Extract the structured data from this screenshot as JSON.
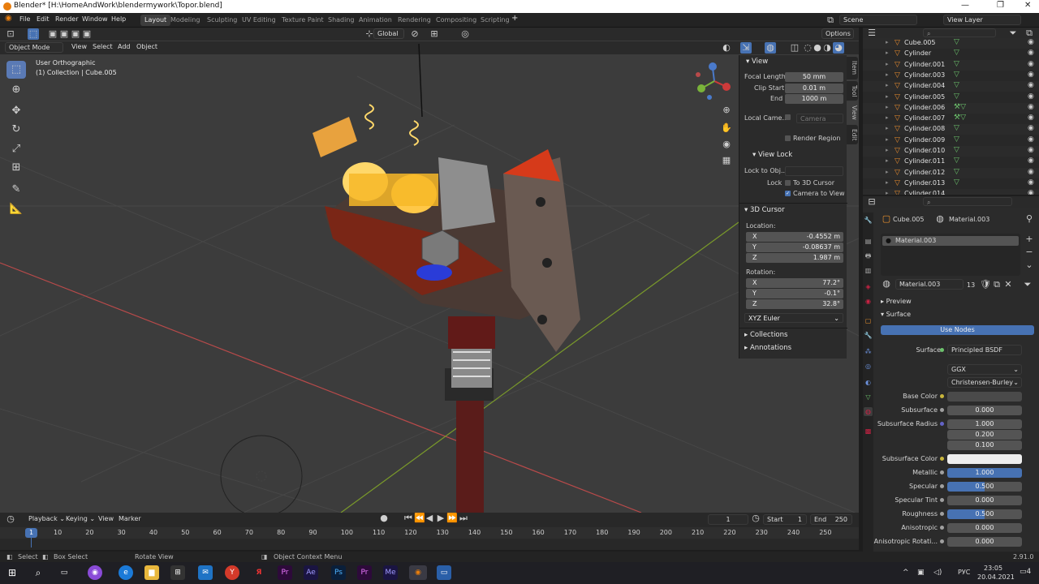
{
  "titlebar": {
    "title": "Blender* [H:\\HomeAndWork\\blendermywork\\Topor.blend]",
    "min": "—",
    "max": "❐",
    "close": "✕"
  },
  "menu": {
    "file": "File",
    "edit": "Edit",
    "render": "Render",
    "window": "Window",
    "help": "Help"
  },
  "workspaces": [
    "Layout",
    "Modeling",
    "Sculpting",
    "UV Editing",
    "Texture Paint",
    "Shading",
    "Animation",
    "Rendering",
    "Compositing",
    "Scripting"
  ],
  "scene": {
    "label": "Scene",
    "view_layer": "View Layer"
  },
  "header": {
    "orientation": "Global",
    "options": "Options",
    "mode": "Object Mode",
    "view": "View",
    "select": "Select",
    "add": "Add",
    "object": "Object"
  },
  "viewport": {
    "view_name": "User Orthographic",
    "collection": "(1) Collection | Cube.005"
  },
  "npanel": {
    "view_section": "View",
    "focal_label": "Focal Length",
    "focal_value": "50 mm",
    "clip_start_label": "Clip Start",
    "clip_start_value": "0.01 m",
    "end_label": "End",
    "end_value": "1000 m",
    "local_camera_label": "Local Came...",
    "camera_value": "Camera",
    "render_region": "Render Region",
    "view_lock": "View Lock",
    "lock_to_obj": "Lock to Obj...",
    "lock": "Lock",
    "to_3d_cursor": "To 3D Cursor",
    "camera_to_view": "Camera to View",
    "cursor_section": "3D Cursor",
    "location": "Location:",
    "x_label": "X",
    "x_value": "-0.4552 m",
    "y_label": "Y",
    "y_value": "-0.08637 m",
    "z_label": "Z",
    "z_value": "1.987 m",
    "rotation": "Rotation:",
    "rx_value": "77.2°",
    "ry_value": "-0.1°",
    "rz_value": "32.8°",
    "euler": "XYZ Euler",
    "collections": "Collections",
    "annotations": "Annotations",
    "tabs": [
      "Item",
      "Tool",
      "View",
      "Edit"
    ]
  },
  "outliner": {
    "items": [
      {
        "name": "Cube.005",
        "icons": "▽"
      },
      {
        "name": "Cylinder",
        "icons": "▽"
      },
      {
        "name": "Cylinder.001",
        "icons": "▽"
      },
      {
        "name": "Cylinder.003",
        "icons": "▽"
      },
      {
        "name": "Cylinder.004",
        "icons": "▽"
      },
      {
        "name": "Cylinder.005",
        "icons": "▽"
      },
      {
        "name": "Cylinder.006",
        "icons": "⚒▽"
      },
      {
        "name": "Cylinder.007",
        "icons": "⚒▽"
      },
      {
        "name": "Cylinder.008",
        "icons": "▽"
      },
      {
        "name": "Cylinder.009",
        "icons": "▽"
      },
      {
        "name": "Cylinder.010",
        "icons": "▽"
      },
      {
        "name": "Cylinder.011",
        "icons": "▽"
      },
      {
        "name": "Cylinder.012",
        "icons": "▽"
      },
      {
        "name": "Cylinder.013",
        "icons": "▽"
      },
      {
        "name": "Cylinder.014",
        "icons": ""
      }
    ]
  },
  "properties": {
    "object": "Cube.005",
    "material": "Material.003",
    "slot": "Material.003",
    "mat_name": "Material.003",
    "users": "13",
    "preview": "Preview",
    "surface_section": "Surface",
    "use_nodes": "Use Nodes",
    "surface_label": "Surface",
    "surface_value": "Principled BSDF",
    "distribution": "GGX",
    "subsurface_method": "Christensen-Burley",
    "rows": [
      {
        "label": "Base Color",
        "value": "",
        "type": "color-dark",
        "dot": "#c8b53c"
      },
      {
        "label": "Subsurface",
        "value": "0.000",
        "type": "plain",
        "dot": "#a0a0a0"
      },
      {
        "label": "Subsurface Radius",
        "value": "1.000",
        "type": "plain",
        "dot": "#6363c7"
      },
      {
        "label": "",
        "value": "0.200",
        "type": "plain",
        "dot": ""
      },
      {
        "label": "",
        "value": "0.100",
        "type": "plain",
        "dot": ""
      },
      {
        "label": "Subsurface Color",
        "value": "",
        "type": "color-white",
        "dot": "#c8b53c"
      },
      {
        "label": "Metallic",
        "value": "1.000",
        "type": "blue",
        "dot": "#a0a0a0"
      },
      {
        "label": "Specular",
        "value": "0.500",
        "type": "half",
        "dot": "#a0a0a0"
      },
      {
        "label": "Specular Tint",
        "value": "0.000",
        "type": "plain",
        "dot": "#a0a0a0"
      },
      {
        "label": "Roughness",
        "value": "0.500",
        "type": "half",
        "dot": "#a0a0a0"
      },
      {
        "label": "Anisotropic",
        "value": "0.000",
        "type": "plain",
        "dot": "#a0a0a0"
      },
      {
        "label": "Anisotropic Rotati...",
        "value": "0.000",
        "type": "plain",
        "dot": "#a0a0a0"
      }
    ]
  },
  "timeline": {
    "playback": "Playback",
    "keying": "Keying",
    "view": "View",
    "marker": "Marker",
    "current_frame": "1",
    "start_label": "Start",
    "start_value": "1",
    "end_label": "End",
    "end_value": "250",
    "playhead": "1",
    "ticks": [
      "10",
      "20",
      "30",
      "40",
      "50",
      "60",
      "70",
      "80",
      "90",
      "100",
      "110",
      "120",
      "130",
      "140",
      "150",
      "160",
      "170",
      "180",
      "190",
      "200",
      "210",
      "220",
      "230",
      "240",
      "250"
    ]
  },
  "status": {
    "select": "Select",
    "box_select": "Box Select",
    "rotate": "Rotate View",
    "context": "Object Context Menu",
    "version": "2.91.0"
  },
  "taskbar": {
    "lang": "РУС",
    "time": "23:05",
    "date": "20.04.2021",
    "notif": "4"
  },
  "colors": {
    "accent": "#4772b3",
    "orange": "#e87d0d",
    "viewport_bg": "#3c3c3c"
  }
}
